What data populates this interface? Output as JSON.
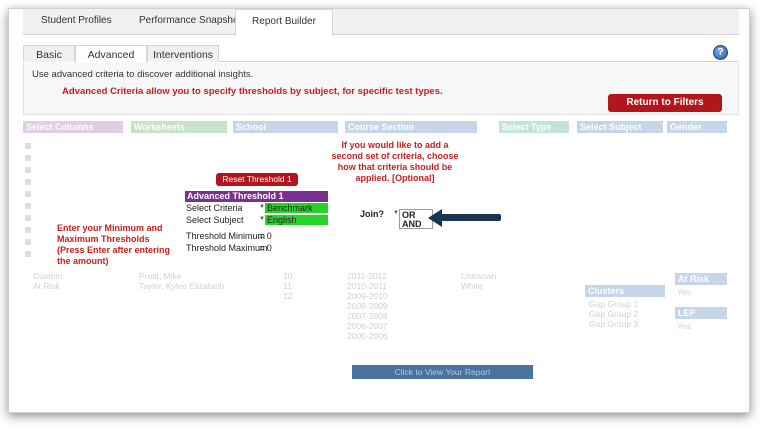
{
  "top_tabs": [
    "Student Profiles",
    "Performance Snapshots",
    "Report Builder"
  ],
  "sub_tabs": [
    "Basic",
    "Advanced",
    "Interventions"
  ],
  "help_label": "?",
  "description": "Use advanced criteria to discover additional insights.",
  "advanced_note": "Advanced Criteria allow you to specify thresholds by subject, for specific test types.",
  "return_button": "Return to Filters",
  "background_columns": [
    "Select Columns",
    "Worksheets",
    "School",
    "Course Section",
    "Select Type",
    "Select Subject",
    "Gender"
  ],
  "background_rows": {
    "columns_list": [
      "Custom",
      "At Risk"
    ],
    "names": [
      "Pruitt, Mike",
      "Taylor, Kylee Elizabeth"
    ],
    "grades": [
      "10",
      "11",
      "12"
    ],
    "years": [
      "2011-2012",
      "2010-2011",
      "2009-2010",
      "2008-2009",
      "2007-2008",
      "2006-2007",
      "2005-2006"
    ],
    "ethnicity": [
      "Unknown",
      "White"
    ],
    "clusters_title": "Clusters",
    "clusters": [
      "Gap Group 1",
      "Gap Group 2",
      "Gap Group 3"
    ],
    "at_risk_title": "At Risk",
    "at_risk_value": "Yes",
    "lep_title": "LEP",
    "lep_value": "Yes"
  },
  "reset_button": "Reset Threshold 1",
  "threshold": {
    "header": "Advanced Threshold 1",
    "criteria_label": "Select Criteria",
    "criteria_value": "Benchmark",
    "subject_label": "Select Subject",
    "subject_value": "English",
    "min_label": "Threshold Minimum",
    "min_value": "= 0",
    "max_label": "Threshold Maximum",
    "max_value": "= 0"
  },
  "notes": {
    "second_set": "If you would like to add a second set of criteria, choose how that criteria should be applied. [Optional]",
    "min_max": "Enter your Minimum and Maximum Thresholds (Press Enter after entering the amount)"
  },
  "join": {
    "label": "Join?",
    "options": [
      "OR",
      "AND"
    ]
  },
  "view_report_button": "Click to View Your Report"
}
